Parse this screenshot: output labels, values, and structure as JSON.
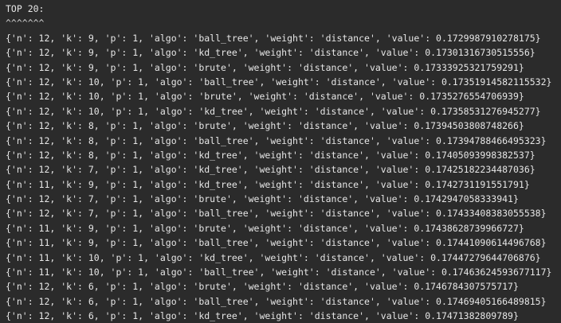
{
  "console": {
    "heading": "TOP 20:",
    "underline": "^^^^^^^",
    "lines": [
      "{'n': 12, 'k': 9, 'p': 1, 'algo': 'ball_tree', 'weight': 'distance', 'value': 0.1729987910278175}",
      "{'n': 12, 'k': 9, 'p': 1, 'algo': 'kd_tree', 'weight': 'distance', 'value': 0.17301316730515556}",
      "{'n': 12, 'k': 9, 'p': 1, 'algo': 'brute', 'weight': 'distance', 'value': 0.17333925321759291}",
      "{'n': 12, 'k': 10, 'p': 1, 'algo': 'ball_tree', 'weight': 'distance', 'value': 0.17351914582115532}",
      "{'n': 12, 'k': 10, 'p': 1, 'algo': 'brute', 'weight': 'distance', 'value': 0.1735276554706939}",
      "{'n': 12, 'k': 10, 'p': 1, 'algo': 'kd_tree', 'weight': 'distance', 'value': 0.17358531276945277}",
      "{'n': 12, 'k': 8, 'p': 1, 'algo': 'brute', 'weight': 'distance', 'value': 0.17394503808748266}",
      "{'n': 12, 'k': 8, 'p': 1, 'algo': 'ball_tree', 'weight': 'distance', 'value': 0.17394788466495323}",
      "{'n': 12, 'k': 8, 'p': 1, 'algo': 'kd_tree', 'weight': 'distance', 'value': 0.17405093998382537}",
      "{'n': 12, 'k': 7, 'p': 1, 'algo': 'kd_tree', 'weight': 'distance', 'value': 0.17425182234487036}",
      "{'n': 11, 'k': 9, 'p': 1, 'algo': 'kd_tree', 'weight': 'distance', 'value': 0.1742731191551791}",
      "{'n': 12, 'k': 7, 'p': 1, 'algo': 'brute', 'weight': 'distance', 'value': 0.1742947058333941}",
      "{'n': 12, 'k': 7, 'p': 1, 'algo': 'ball_tree', 'weight': 'distance', 'value': 0.17433408383055538}",
      "{'n': 11, 'k': 9, 'p': 1, 'algo': 'brute', 'weight': 'distance', 'value': 0.17438628739966727}",
      "{'n': 11, 'k': 9, 'p': 1, 'algo': 'ball_tree', 'weight': 'distance', 'value': 0.17441090614496768}",
      "{'n': 11, 'k': 10, 'p': 1, 'algo': 'kd_tree', 'weight': 'distance', 'value': 0.17447279644706876}",
      "{'n': 11, 'k': 10, 'p': 1, 'algo': 'ball_tree', 'weight': 'distance', 'value': 0.17463624593677117}",
      "{'n': 12, 'k': 6, 'p': 1, 'algo': 'brute', 'weight': 'distance', 'value': 0.1746784307575717}",
      "{'n': 12, 'k': 6, 'p': 1, 'algo': 'ball_tree', 'weight': 'distance', 'value': 0.17469405166489815}",
      "{'n': 12, 'k': 6, 'p': 1, 'algo': 'kd_tree', 'weight': 'distance', 'value': 0.17471382809789}"
    ]
  }
}
